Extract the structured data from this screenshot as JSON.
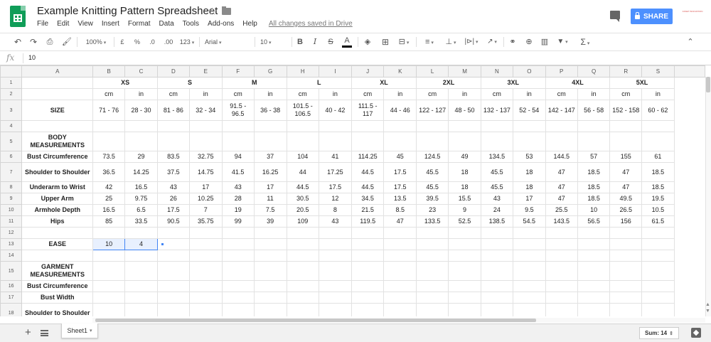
{
  "app": {
    "doc_title": "Example Knitting Pattern Spreadsheet",
    "save_status": "All changes saved in Drive",
    "share_label": "SHARE",
    "account_logo_text": "ASSET INNOVATION",
    "star_icon": "☆"
  },
  "menu": [
    "File",
    "Edit",
    "View",
    "Insert",
    "Format",
    "Data",
    "Tools",
    "Add-ons",
    "Help"
  ],
  "toolbar": {
    "zoom": "100%",
    "currency": "£",
    "percent": "%",
    "decimal_less": ".0",
    "decimal_more": ".00",
    "more_formats": "123",
    "font": "Arial",
    "font_size": "10",
    "bold": "B",
    "italic": "I",
    "strikethrough": "S",
    "text_color": "A",
    "functions": "Σ"
  },
  "formula_bar": {
    "fx_label": "fx",
    "value": "10"
  },
  "grid": {
    "columns": [
      "A",
      "B",
      "C",
      "D",
      "E",
      "F",
      "G",
      "H",
      "I",
      "J",
      "K",
      "L",
      "M",
      "N",
      "O",
      "P",
      "Q",
      "R",
      "S"
    ],
    "row_numbers": [
      "1",
      "2",
      "3",
      "4",
      "5",
      "6",
      "7",
      "8",
      "9",
      "10",
      "11",
      "12",
      "13",
      "14",
      "15",
      "16",
      "17",
      "18"
    ],
    "size_headers": [
      "XS",
      "S",
      "M",
      "L",
      "XL",
      "2XL",
      "3XL",
      "4XL",
      "5XL"
    ],
    "unit_row": [
      "cm",
      "in",
      "cm",
      "in",
      "cm",
      "in",
      "cm",
      "in",
      "cm",
      "in",
      "cm",
      "in",
      "cm",
      "in",
      "cm",
      "in",
      "cm",
      "in"
    ],
    "rows": {
      "size": {
        "label": "SIZE",
        "values": [
          "71 - 76",
          "28 - 30",
          "81 - 86",
          "32 - 34",
          "91.5 - 96.5",
          "36 - 38",
          "101.5 - 106.5",
          "40 - 42",
          "111.5 - 117",
          "44 - 46",
          "122 - 127",
          "48 - 50",
          "132 - 137",
          "52 - 54",
          "142 - 147",
          "56 - 58",
          "152 - 158",
          "60 - 62"
        ]
      },
      "body_measurements": {
        "label": "BODY MEASUREMENTS"
      },
      "bust": {
        "label": "Bust Circumference",
        "values": [
          "73.5",
          "29",
          "83.5",
          "32.75",
          "94",
          "37",
          "104",
          "41",
          "114.25",
          "45",
          "124.5",
          "49",
          "134.5",
          "53",
          "144.5",
          "57",
          "155",
          "61"
        ]
      },
      "shoulder": {
        "label": "Shoulder to Shoulder",
        "values": [
          "36.5",
          "14.25",
          "37.5",
          "14.75",
          "41.5",
          "16.25",
          "44",
          "17.25",
          "44.5",
          "17.5",
          "45.5",
          "18",
          "45.5",
          "18",
          "47",
          "18.5",
          "47",
          "18.5"
        ]
      },
      "underarm": {
        "label": "Underarm to Wrist",
        "values": [
          "42",
          "16.5",
          "43",
          "17",
          "43",
          "17",
          "44.5",
          "17.5",
          "44.5",
          "17.5",
          "45.5",
          "18",
          "45.5",
          "18",
          "47",
          "18.5",
          "47",
          "18.5"
        ]
      },
      "upper_arm": {
        "label": "Upper Arm",
        "values": [
          "25",
          "9.75",
          "26",
          "10.25",
          "28",
          "11",
          "30.5",
          "12",
          "34.5",
          "13.5",
          "39.5",
          "15.5",
          "43",
          "17",
          "47",
          "18.5",
          "49.5",
          "19.5"
        ]
      },
      "armhole": {
        "label": "Armhole Depth",
        "values": [
          "16.5",
          "6.5",
          "17.5",
          "7",
          "19",
          "7.5",
          "20.5",
          "8",
          "21.5",
          "8.5",
          "23",
          "9",
          "24",
          "9.5",
          "25.5",
          "10",
          "26.5",
          "10.5"
        ]
      },
      "hips": {
        "label": "Hips",
        "values": [
          "85",
          "33.5",
          "90.5",
          "35.75",
          "99",
          "39",
          "109",
          "43",
          "119.5",
          "47",
          "133.5",
          "52.5",
          "138.5",
          "54.5",
          "143.5",
          "56.5",
          "156",
          "61.5"
        ]
      },
      "ease": {
        "label": "EASE",
        "values": [
          "10",
          "4"
        ]
      },
      "garment_measurements": {
        "label": "GARMENT MEASUREMENTS"
      },
      "garment_bust": {
        "label": "Bust Circumference"
      },
      "garment_bust_width": {
        "label": "Bust Width"
      },
      "garment_shoulder": {
        "label": "Shoulder to Shoulder"
      }
    }
  },
  "bottom": {
    "sheet_tab": "Sheet1",
    "sum_label": "Sum: 14"
  },
  "colors": {
    "brand_green": "#0f9d58",
    "share_blue": "#4d90fe",
    "selection_blue": "#4285f4"
  },
  "icons": [
    "sheets-logo-icon",
    "star-icon",
    "folder-icon",
    "comment-icon",
    "lock-icon",
    "undo-icon",
    "redo-icon",
    "print-icon",
    "paint-format-icon",
    "text-color-icon",
    "fill-color-icon",
    "borders-icon",
    "merge-icon",
    "align-icon",
    "valign-icon",
    "wrap-icon",
    "rotate-icon",
    "link-icon",
    "comment-add-icon",
    "chart-icon",
    "filter-icon",
    "functions-icon",
    "collapse-icon",
    "add-sheet-icon",
    "sheets-list-icon",
    "explore-icon"
  ]
}
